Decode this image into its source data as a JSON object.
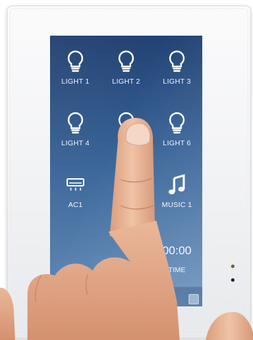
{
  "panel": {
    "tiles": [
      {
        "label": "LIGHT 1",
        "icon": "bulb-icon"
      },
      {
        "label": "LIGHT 2",
        "icon": "bulb-icon"
      },
      {
        "label": "LIGHT 3",
        "icon": "bulb-icon"
      },
      {
        "label": "LIGHT 4",
        "icon": "bulb-icon"
      },
      {
        "label": "",
        "icon": "bulb-icon"
      },
      {
        "label": "LIGHT 6",
        "icon": "bulb-icon"
      },
      {
        "label": "AC1",
        "icon": "air-conditioner-icon"
      },
      {
        "label": "MUSIC 1",
        "icon": "music-note-icon"
      }
    ],
    "time": {
      "value": "00:00",
      "label": "TIME"
    }
  },
  "colors": {
    "screen_top": "#1d3b6d",
    "screen_bottom": "#6d94bf",
    "bezel": "#f1f2f4",
    "skin": "#e8b79a"
  }
}
